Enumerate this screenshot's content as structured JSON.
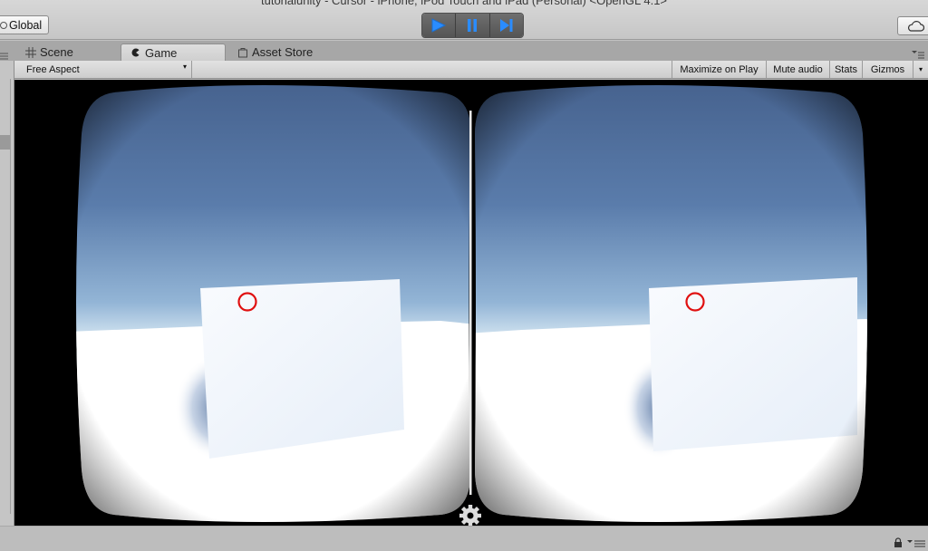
{
  "window": {
    "title": "tutorialunity - Cursor - iPhone, iPod Touch and iPad (Personal) <OpenGL 4.1>"
  },
  "toolbar": {
    "global_label": "Global",
    "play_icon": "play-icon",
    "pause_icon": "pause-icon",
    "step_icon": "step-icon",
    "cloud_icon": "cloud-icon",
    "accent_color": "#2a8cff"
  },
  "tabs": [
    {
      "label": "Scene",
      "icon": "scene-grid-icon"
    },
    {
      "label": "Game",
      "icon": "game-icon",
      "active": true
    },
    {
      "label": "Asset Store",
      "icon": "asset-store-icon"
    }
  ],
  "game_toolbar": {
    "aspect": "Free Aspect",
    "maximize_on_play": "Maximize on Play",
    "mute_audio": "Mute audio",
    "stats": "Stats",
    "gizmos": "Gizmos"
  },
  "viewport": {
    "mode": "VR stereo split view",
    "reticle_color": "#e01010",
    "settings_icon": "gear-icon"
  },
  "statusbar": {
    "lock_icon": "lock-icon",
    "menu_icon": "menu-icon"
  }
}
